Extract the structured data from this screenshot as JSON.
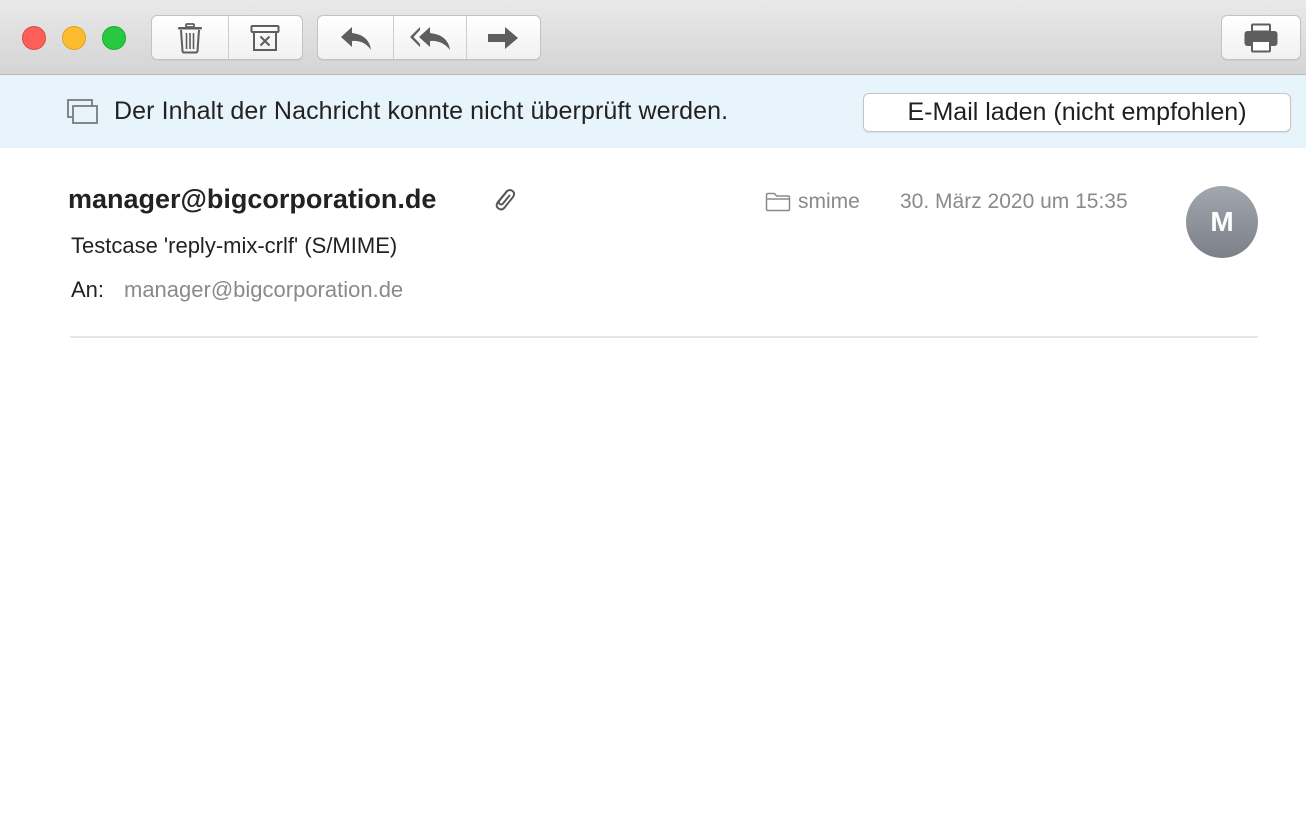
{
  "toolbar": {
    "buttons": {
      "delete": "trash-icon",
      "junk": "junk-box-icon",
      "reply": "reply-icon",
      "reply_all": "reply-all-icon",
      "forward": "forward-icon",
      "print": "printer-icon"
    }
  },
  "banner": {
    "message": "Der Inhalt der Nachricht konnte nicht überprüft werden.",
    "load_button": "E-Mail laden (nicht empfohlen)",
    "background": "#e8f4fb"
  },
  "message": {
    "sender": "manager@bigcorporation.de",
    "folder": "smime",
    "date": "30. März 2020 um 15:35",
    "avatar_initial": "M",
    "subject": "Testcase 'reply-mix-crlf' (S/MIME)",
    "to_label": "An:",
    "to_address": "manager@bigcorporation.de"
  }
}
